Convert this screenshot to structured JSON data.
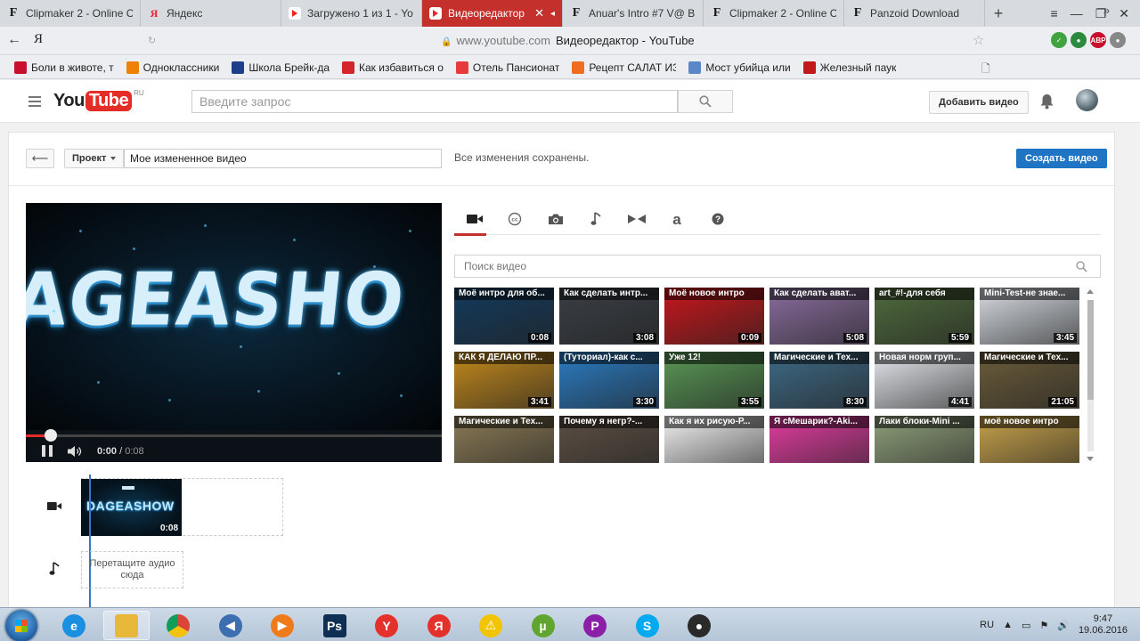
{
  "browser": {
    "tabs": [
      {
        "label": "Clipmaker 2 - Online C",
        "favicon": "clipmaker-favicon-icon",
        "active": false
      },
      {
        "label": "Яндекс",
        "favicon": "yandex-favicon-icon",
        "active": false
      },
      {
        "label": "Загружено 1 из 1 - Yo",
        "favicon": "youtube-favicon-icon",
        "active": false
      },
      {
        "label": "Видеоредактор",
        "favicon": "youtube-favicon-icon",
        "active": true
      },
      {
        "label": "Anuar's Intro #7 V@ B",
        "favicon": "clipmaker-favicon-icon",
        "active": false
      },
      {
        "label": "Clipmaker 2 - Online C",
        "favicon": "clipmaker-favicon-icon",
        "active": false
      },
      {
        "label": "Panzoid Download",
        "favicon": "clipmaker-favicon-icon",
        "active": false
      }
    ],
    "yandex_button": "Я",
    "url_domain": "www.youtube.com",
    "page_title": "Видеоредактор - YouTube",
    "extension_badge": "ABP",
    "bookmarks": [
      {
        "label": "Боли в животе, т",
        "color": "#c8102e"
      },
      {
        "label": "Одноклассники",
        "color": "#ee8208"
      },
      {
        "label": "Школа Брейк-да",
        "color": "#1d3f8a"
      },
      {
        "label": "Как избавиться о",
        "color": "#d4262a"
      },
      {
        "label": "Отель Пансионат",
        "color": "#e8393d"
      },
      {
        "label": "Рецепт САЛАТ ИЗ",
        "color": "#ef6d1f"
      },
      {
        "label": "Мост убийца или",
        "color": "#5b87c7"
      },
      {
        "label": "Железный паук",
        "color": "#c21a1a"
      }
    ]
  },
  "youtube": {
    "logo_you": "You",
    "logo_tube": "Tube",
    "logo_region": "RU",
    "search_placeholder": "Введите запрос",
    "add_video_label": "Добавить видео"
  },
  "editor": {
    "project_label": "Проект",
    "video_title": "Мое измененное видео",
    "saved_message": "Все изменения сохранены.",
    "create_label": "Создать видео",
    "player": {
      "preview_text": "AGEASHO",
      "current_time": "0:00",
      "duration": "0:08",
      "progress_fraction": 0.06
    },
    "tools": [
      {
        "name": "video-camera-icon",
        "active": true
      },
      {
        "name": "cc-icon",
        "active": false
      },
      {
        "name": "photo-camera-icon",
        "active": false
      },
      {
        "name": "music-note-icon",
        "active": false
      },
      {
        "name": "transitions-icon",
        "active": false
      },
      {
        "name": "text-icon",
        "active": false
      },
      {
        "name": "help-icon",
        "active": false
      }
    ],
    "search_placeholder": "Поиск видео",
    "videos": [
      {
        "title": "Моё интро для об...",
        "duration": "0:08",
        "bg": "#123a5c"
      },
      {
        "title": "Как сделать интр...",
        "duration": "3:08",
        "bg": "#3a3f45"
      },
      {
        "title": "Моё новое интро",
        "duration": "0:09",
        "bg": "#c9161a"
      },
      {
        "title": "Как сделать ават...",
        "duration": "5:08",
        "bg": "#8a6d9e"
      },
      {
        "title": "art_#!-для себя",
        "duration": "5:59",
        "bg": "#4f6b3c"
      },
      {
        "title": "Mini-Test-не знае...",
        "duration": "3:45",
        "bg": "#d8dde3"
      },
      {
        "title": "КАК Я ДЕЛАЮ ПР...",
        "duration": "3:41",
        "bg": "#c48a1c"
      },
      {
        "title": "(Туториал)-как с...",
        "duration": "3:30",
        "bg": "#2a7dc4"
      },
      {
        "title": "Уже 12!",
        "duration": "3:55",
        "bg": "#5a9a56"
      },
      {
        "title": "Магические и Тех...",
        "duration": "8:30",
        "bg": "#3e6a86"
      },
      {
        "title": "Новая норм груп...",
        "duration": "4:41",
        "bg": "#e6e9ee"
      },
      {
        "title": "Магические и Тех...",
        "duration": "21:05",
        "bg": "#6c5d3a"
      },
      {
        "title": "Магические и Тех...",
        "duration": "",
        "bg": "#8a7a55"
      },
      {
        "title": "Почему я негр?-...",
        "duration": "",
        "bg": "#5c4f44"
      },
      {
        "title": "Как я их рисую-Р...",
        "duration": "",
        "bg": "#f2f2f2"
      },
      {
        "title": "Я сМешарик?-Aki...",
        "duration": "",
        "bg": "#e23ca0"
      },
      {
        "title": "Лаки блоки-Mini ...",
        "duration": "",
        "bg": "#8fa07a"
      },
      {
        "title": "моё новое интро",
        "duration": "",
        "bg": "#c7a24a"
      }
    ],
    "timeline": {
      "clip_text": "DAGEASHOW",
      "clip_duration": "0:08",
      "audio_drop_text": "Перетащите аудио сюда"
    }
  },
  "taskbar": {
    "apps": [
      {
        "name": "ie-icon",
        "color": "#1b8fe0",
        "glyph": "e"
      },
      {
        "name": "explorer-icon",
        "color": "#e7b83a",
        "glyph": ""
      },
      {
        "name": "chrome-icon",
        "color": "#d53a2c",
        "glyph": ""
      },
      {
        "name": "audio-app-icon",
        "color": "#3b6fb0",
        "glyph": "◀"
      },
      {
        "name": "media-player-icon",
        "color": "#ef7a1a",
        "glyph": "▶"
      },
      {
        "name": "photoshop-icon",
        "color": "#0f2e53",
        "glyph": "Ps"
      },
      {
        "name": "yandex-browser-icon",
        "color": "#e4312b",
        "glyph": "Y"
      },
      {
        "name": "yandex-icon",
        "color": "#e4312b",
        "glyph": "Я"
      },
      {
        "name": "warning-app-icon",
        "color": "#f2c500",
        "glyph": "⚠"
      },
      {
        "name": "utorrent-icon",
        "color": "#5fa52f",
        "glyph": "µ"
      },
      {
        "name": "purple-app-icon",
        "color": "#8c1fa8",
        "glyph": "P"
      },
      {
        "name": "skype-icon",
        "color": "#00a9f0",
        "glyph": "S"
      },
      {
        "name": "obs-icon",
        "color": "#2a2a2a",
        "glyph": "●"
      }
    ],
    "language": "RU",
    "time": "9:47",
    "date": "19.06.2016"
  }
}
